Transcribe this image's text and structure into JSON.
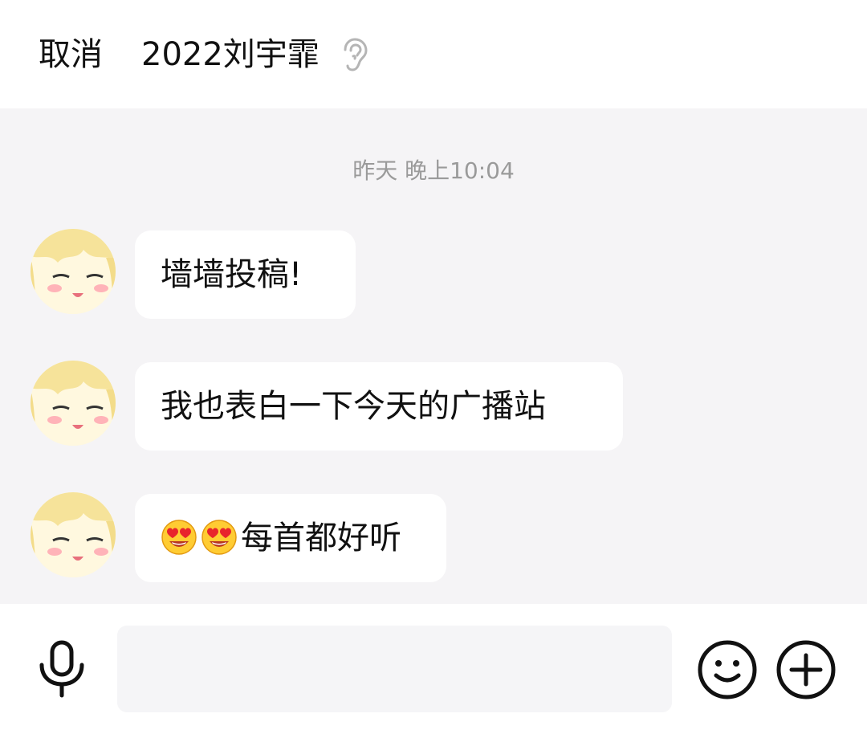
{
  "header": {
    "cancel_label": "取消",
    "title": "2022刘宇霏",
    "icon": "ear-icon"
  },
  "chat": {
    "timestamp": "昨天 晚上10:04",
    "messages": [
      {
        "text": "墙墙投稿!"
      },
      {
        "text": "我也表白一下今天的广播站"
      },
      {
        "emoji_prefix": [
          "heart-eyes-emoji",
          "heart-eyes-emoji"
        ],
        "text": "每首都好听"
      }
    ]
  },
  "input_bar": {
    "icons": [
      "microphone-icon",
      "smile-icon",
      "plus-icon"
    ],
    "input_value": "",
    "input_placeholder": ""
  },
  "colors": {
    "chat_background": "#f5f4f6",
    "bubble": "#ffffff",
    "timestamp": "#9a9a9a",
    "input_background": "#f5f5f7"
  }
}
